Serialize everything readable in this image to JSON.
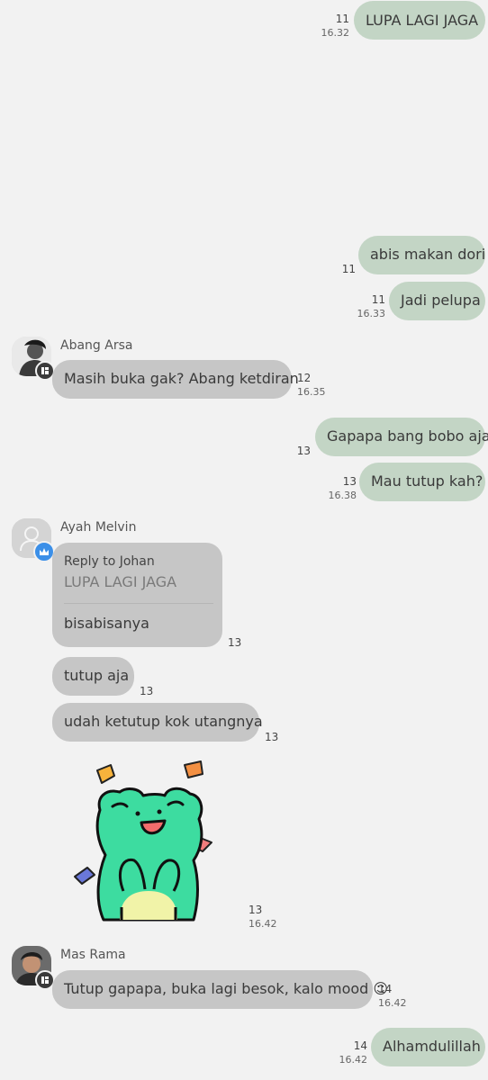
{
  "colors": {
    "background": "#f2f2f2",
    "outgoing_bubble": "#c3d5c5",
    "incoming_bubble": "#c6c6c6",
    "crown_badge": "#3b8fe8",
    "frog_green": "#3ddca0"
  },
  "messages": {
    "m1": {
      "text": "LUPA LAGI JAGA",
      "read": "11",
      "time": "16.32"
    },
    "m2": {
      "text": "abis makan dori",
      "read": "11"
    },
    "m3": {
      "text": "Jadi pelupa",
      "read": "11",
      "time": "16.33"
    },
    "m4": {
      "sender": "Abang Arsa",
      "text": "Masih buka gak? Abang ketdiran",
      "read": "12",
      "time": "16.35"
    },
    "m5": {
      "text": "Gapapa bang bobo aja",
      "read": "13"
    },
    "m6": {
      "text": "Mau tutup kah?",
      "read": "13",
      "time": "16.38"
    },
    "m7": {
      "sender": "Ayah Melvin",
      "reply_label": "Reply to Johan",
      "reply_quote": "LUPA LAGI JAGA",
      "text": "bisabisanya",
      "read": "13"
    },
    "m8": {
      "text": "tutup aja",
      "read": "13"
    },
    "m9": {
      "text": "udah ketutup kok utangnya",
      "read": "13"
    },
    "m10": {
      "sticker": "frog-sticker",
      "read": "13",
      "time": "16.42"
    },
    "m11": {
      "sender": "Mas Rama",
      "text": "Tutup gapapa, buka lagi besok, kalo mood ☺",
      "read": "14",
      "time": "16.42"
    },
    "m12": {
      "text": "Alhamdulillah",
      "read": "14",
      "time": "16.42"
    }
  }
}
